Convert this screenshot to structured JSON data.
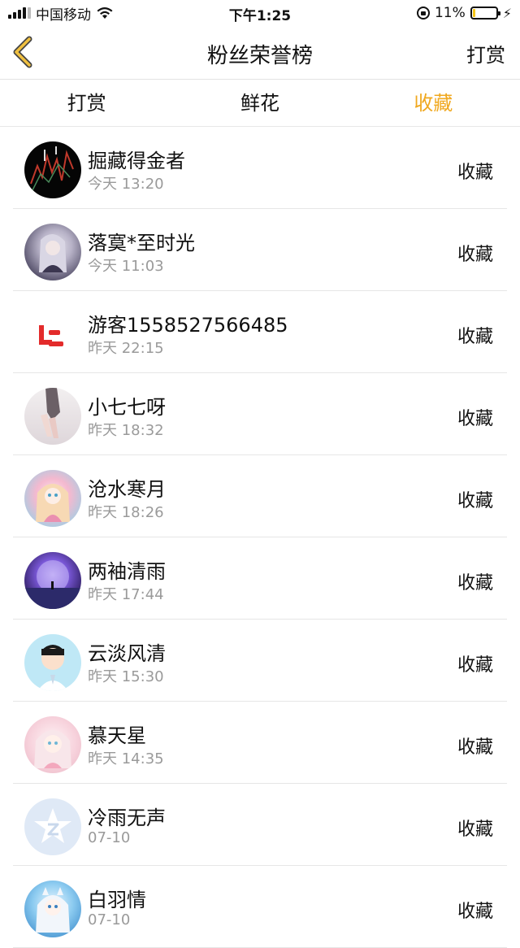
{
  "status_bar": {
    "carrier": "中国移动",
    "time": "下午1:25",
    "battery": "11%",
    "battery_level": 0.11,
    "icons": [
      "signal-icon",
      "wifi-icon",
      "orientation-lock-icon",
      "battery-icon",
      "charging-bolt-icon"
    ]
  },
  "nav": {
    "back_icon": "chevron-left-icon",
    "title": "粉丝荣誉榜",
    "right_label": "打赏",
    "back_color": "#f0a81f"
  },
  "tabs": [
    {
      "label": "打赏",
      "active": false
    },
    {
      "label": "鲜花",
      "active": false
    },
    {
      "label": "收藏",
      "active": true
    }
  ],
  "accent_color": "#f0a81f",
  "list": [
    {
      "name": "掘藏得金者",
      "time": "今天 13:20",
      "action": "收藏",
      "avatar": "dark-stock-chart"
    },
    {
      "name": "落寞*至时光",
      "time": "今天 11:03",
      "action": "收藏",
      "avatar": "anime-girl-grey"
    },
    {
      "name": "游客1558527566485",
      "time": "昨天 22:15",
      "action": "收藏",
      "avatar": "red-le-logo"
    },
    {
      "name": "小七七呀",
      "time": "昨天 18:32",
      "action": "收藏",
      "avatar": "photo-legs"
    },
    {
      "name": "沧水寒月",
      "time": "昨天 18:26",
      "action": "收藏",
      "avatar": "anime-girl-pink"
    },
    {
      "name": "两袖清雨",
      "time": "昨天 17:44",
      "action": "收藏",
      "avatar": "purple-moon"
    },
    {
      "name": "云淡风清",
      "time": "昨天 15:30",
      "action": "收藏",
      "avatar": "cartoon-boy"
    },
    {
      "name": "慕天星",
      "time": "昨天 14:35",
      "action": "收藏",
      "avatar": "anime-girl-light"
    },
    {
      "name": "冷雨无声",
      "time": "07-10",
      "action": "收藏",
      "avatar": "default-star-avatar"
    },
    {
      "name": "白羽情",
      "time": "07-10",
      "action": "收藏",
      "avatar": "anime-girl-blue"
    }
  ]
}
